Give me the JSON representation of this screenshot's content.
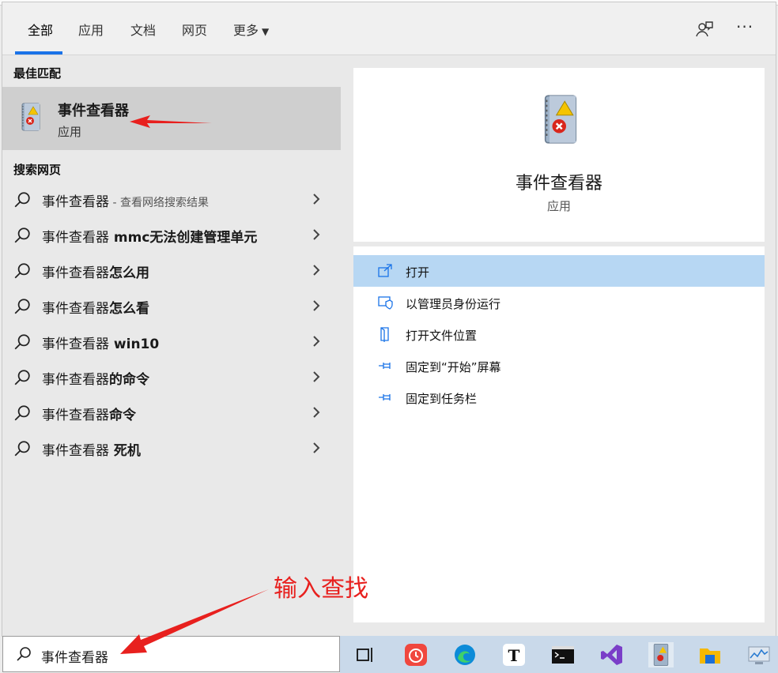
{
  "tabs": [
    {
      "label": "全部",
      "active": true
    },
    {
      "label": "应用"
    },
    {
      "label": "文档"
    },
    {
      "label": "网页"
    },
    {
      "label": "更多"
    }
  ],
  "toolbar": {
    "feedback_icon": "feedback-icon",
    "more_icon": "more-options-icon"
  },
  "best_match": {
    "heading": "最佳匹配",
    "title": "事件查看器",
    "subtitle": "应用",
    "icon": "event-viewer-icon"
  },
  "web_search": {
    "heading": "搜索网页",
    "items": [
      {
        "text": "事件查看器",
        "bold": "",
        "hint": " - 查看网络搜索结果"
      },
      {
        "text": "事件查看器",
        "bold": " mmc无法创建管理单元",
        "hint": ""
      },
      {
        "text": "事件查看器",
        "bold": "怎么用",
        "hint": ""
      },
      {
        "text": "事件查看器",
        "bold": "怎么看",
        "hint": ""
      },
      {
        "text": "事件查看器",
        "bold": " win10",
        "hint": ""
      },
      {
        "text": "事件查看器",
        "bold": "的命令",
        "hint": ""
      },
      {
        "text": "事件查看器",
        "bold": "命令",
        "hint": ""
      },
      {
        "text": "事件查看器",
        "bold": " 死机",
        "hint": ""
      }
    ]
  },
  "detail": {
    "name": "事件查看器",
    "kind": "应用",
    "actions": [
      {
        "label": "打开",
        "icon": "open-icon",
        "highlighted": true
      },
      {
        "label": "以管理员身份运行",
        "icon": "shield-icon"
      },
      {
        "label": "打开文件位置",
        "icon": "file-location-icon"
      },
      {
        "label": "固定到“开始”屏幕",
        "icon": "pin-icon"
      },
      {
        "label": "固定到任务栏",
        "icon": "pin-icon"
      }
    ]
  },
  "search": {
    "value": "事件查看器"
  },
  "annotation": {
    "text": "输入查找",
    "color": "#e8201e"
  },
  "taskbar": [
    "task-view-icon",
    "calendar-app-icon",
    "edge-icon",
    "typora-icon",
    "terminal-icon",
    "visual-studio-icon",
    "event-viewer-icon",
    "file-explorer-icon",
    "performance-monitor-icon"
  ],
  "colors": {
    "accent": "#1a73e8",
    "highlight": "#b7d7f3",
    "arrow": "#e8201e"
  }
}
